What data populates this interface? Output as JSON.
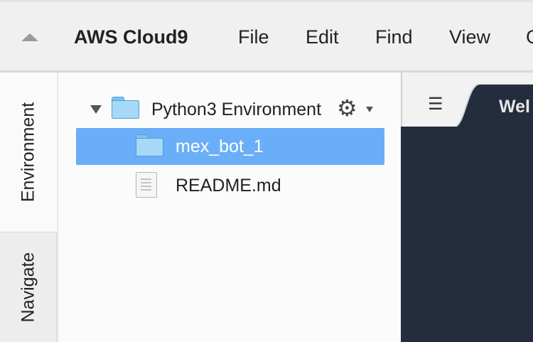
{
  "menubar": {
    "brand": "AWS Cloud9",
    "items": [
      "File",
      "Edit",
      "Find",
      "View",
      "G"
    ]
  },
  "side_tabs": {
    "environment": "Environment",
    "navigate": "Navigate"
  },
  "tree": {
    "root_label": "Python3 Environment",
    "folder_label": "mex_bot_1",
    "file_label": "README.md"
  },
  "editor": {
    "tab_label": "Wel"
  },
  "colors": {
    "selection": "#6aaef8",
    "editor_bg": "#232d3d",
    "folder_fill": "#a7d8f5"
  }
}
